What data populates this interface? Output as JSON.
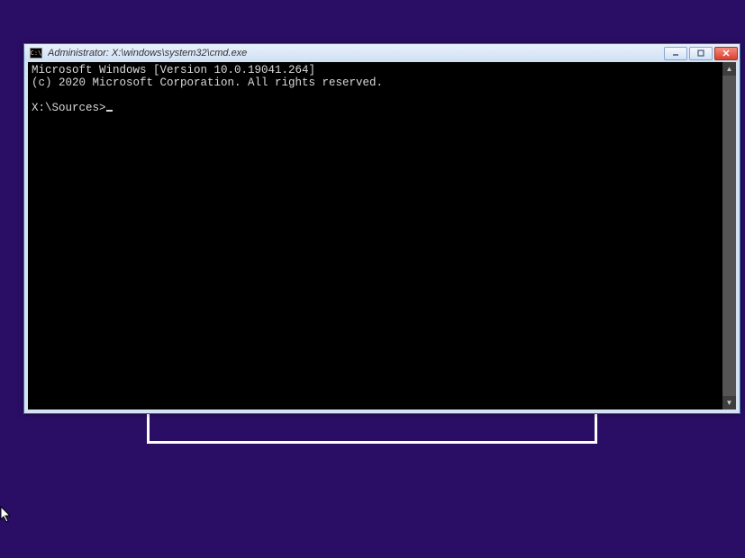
{
  "window": {
    "title": "Administrator: X:\\windows\\system32\\cmd.exe",
    "icon_label": "CMD"
  },
  "terminal": {
    "line1": "Microsoft Windows [Version 10.0.19041.264]",
    "line2": "(c) 2020 Microsoft Corporation. All rights reserved.",
    "blank": "",
    "prompt": "X:\\Sources>"
  }
}
